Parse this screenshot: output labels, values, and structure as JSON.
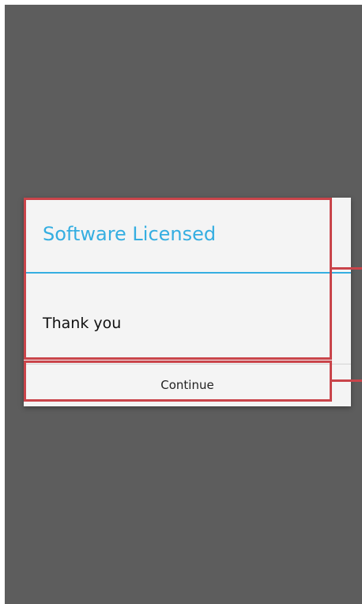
{
  "dialog": {
    "title": "Software Licensed",
    "message": "Thank you",
    "button_label": "Continue"
  },
  "colors": {
    "background_dim": "#5d5d5d",
    "dialog_bg": "#f4f4f4",
    "accent": "#35aee1",
    "annotation": "#c9444a"
  }
}
